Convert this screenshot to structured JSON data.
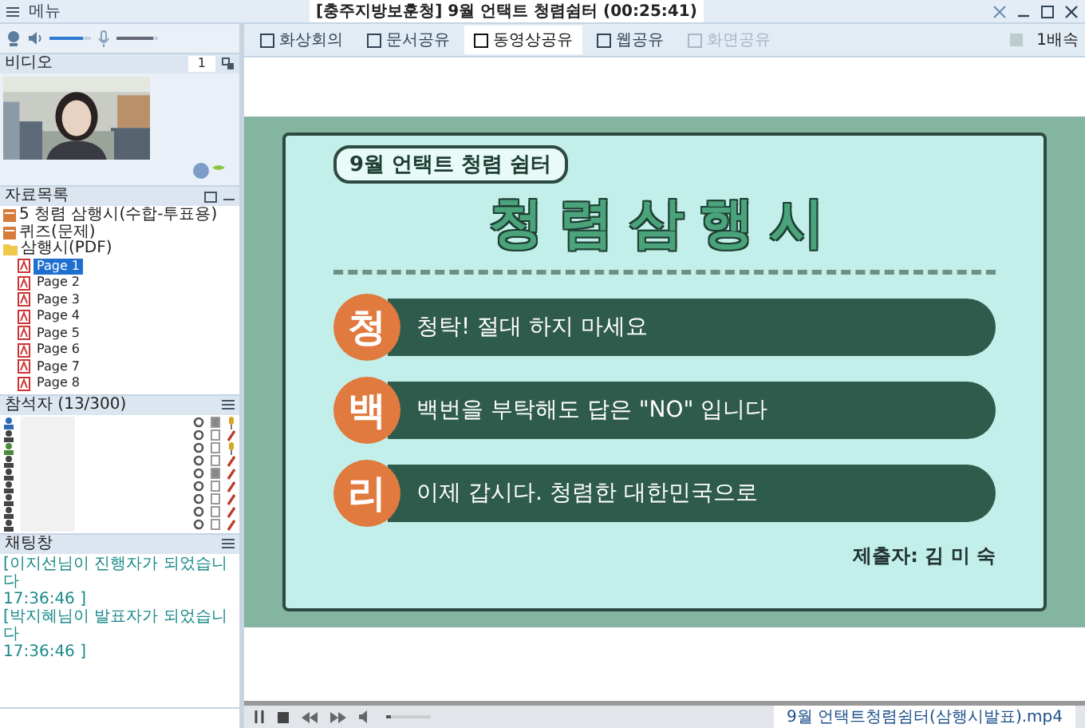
{
  "window": {
    "title": "[충주지방보훈청] 9월 언택트 청렴쉼터 (00:25:41)",
    "menu": "메뉴"
  },
  "tabs": [
    {
      "label": "화상회의",
      "selected": false,
      "disabled": false
    },
    {
      "label": "문서공유",
      "selected": false,
      "disabled": false
    },
    {
      "label": "동영상공유",
      "selected": true,
      "disabled": false
    },
    {
      "label": "웹공유",
      "selected": false,
      "disabled": false
    },
    {
      "label": "화면공유",
      "selected": false,
      "disabled": true
    }
  ],
  "speed": "1배속",
  "video_panel": {
    "title": "비디오",
    "count": "1"
  },
  "files": {
    "title": "자료목록",
    "items": [
      {
        "label": "5 청렴 삼행시(수합-투표용)",
        "kind": "doc",
        "selected": false
      },
      {
        "label": "퀴즈(문제)",
        "kind": "doc",
        "selected": false
      },
      {
        "label": "삼행시(PDF)",
        "kind": "folder",
        "selected": false,
        "children": [
          {
            "label": "Page 1",
            "kind": "page",
            "selected": true
          },
          {
            "label": "Page 2",
            "kind": "page",
            "selected": false
          },
          {
            "label": "Page 3",
            "kind": "page",
            "selected": false
          },
          {
            "label": "Page 4",
            "kind": "page",
            "selected": false
          },
          {
            "label": "Page 5",
            "kind": "page",
            "selected": false
          },
          {
            "label": "Page 6",
            "kind": "page",
            "selected": false
          },
          {
            "label": "Page 7",
            "kind": "page",
            "selected": false
          },
          {
            "label": "Page 8",
            "kind": "page",
            "selected": false
          }
        ]
      }
    ]
  },
  "participants": {
    "title": "참석자 (13/300)",
    "rows": [
      {
        "kind": "host",
        "doc": true,
        "mic": true
      },
      {
        "kind": "user",
        "doc": false,
        "mic": false
      },
      {
        "kind": "presenter",
        "doc": false,
        "mic": true
      },
      {
        "kind": "user",
        "doc": false,
        "mic": false
      },
      {
        "kind": "user",
        "doc": true,
        "mic": false
      },
      {
        "kind": "user",
        "doc": false,
        "mic": false
      },
      {
        "kind": "user",
        "doc": false,
        "mic": false
      },
      {
        "kind": "user",
        "doc": false,
        "mic": false
      },
      {
        "kind": "user",
        "doc": false,
        "mic": false
      }
    ]
  },
  "audio": {
    "speaker": {
      "level": 0.8
    },
    "mic": {
      "level": 0.9
    }
  },
  "chat": {
    "title": "채팅창",
    "messages": [
      "[이지선님이 진행자가 되었습니다",
      "17:36:46 ]",
      "[박지혜님이 발표자가 되었습니다",
      "17:36:46 ]"
    ]
  },
  "slide": {
    "subtitle": "9월 언택트 청렴 쉼터",
    "title": "청렴삼행시",
    "lines": [
      {
        "initial": "청",
        "text": "청탁!  절대 하지 마세요"
      },
      {
        "initial": "백",
        "text": "백번을 부탁해도 답은 \"NO\" 입니다"
      },
      {
        "initial": "리",
        "text": "이제 갑시다. 청렴한 대한민국으로"
      }
    ],
    "author": "제출자: 김 미 숙"
  },
  "player": {
    "volume": {
      "level": 0.1
    },
    "file": "9월 언택트청렴쉼터(삼행시발표).mp4"
  }
}
